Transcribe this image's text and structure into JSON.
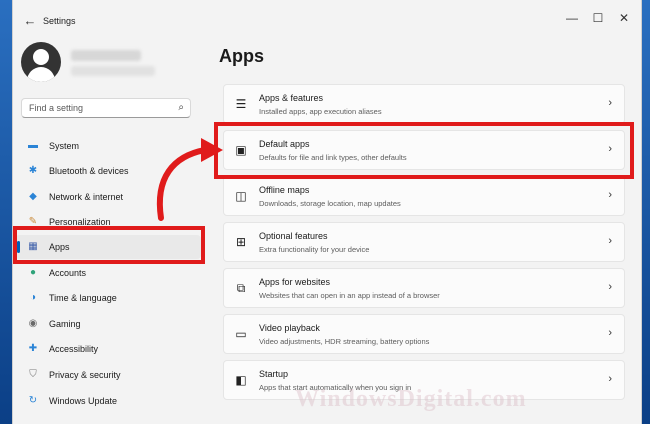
{
  "window": {
    "title": "Settings",
    "back_icon": "back-arrow-icon",
    "controls": {
      "minimize": "—",
      "maximize": "☐",
      "close": "✕"
    }
  },
  "search": {
    "placeholder": "Find a setting",
    "icon": "search-icon"
  },
  "sidebar": {
    "items": [
      {
        "label": "System",
        "icon": "monitor-icon",
        "color": "#2b84d6"
      },
      {
        "label": "Bluetooth & devices",
        "icon": "bluetooth-icon",
        "color": "#2b84d6"
      },
      {
        "label": "Network & internet",
        "icon": "wifi-icon",
        "color": "#2b84d6"
      },
      {
        "label": "Personalization",
        "icon": "brush-icon",
        "color": "#c98a3a"
      },
      {
        "label": "Apps",
        "icon": "apps-icon",
        "color": "#3a5ca8",
        "active": true
      },
      {
        "label": "Accounts",
        "icon": "person-icon",
        "color": "#2fa37a"
      },
      {
        "label": "Time & language",
        "icon": "globe-clock-icon",
        "color": "#2b84d6"
      },
      {
        "label": "Gaming",
        "icon": "gamepad-icon",
        "color": "#6a6a6a"
      },
      {
        "label": "Accessibility",
        "icon": "accessibility-icon",
        "color": "#2b84d6"
      },
      {
        "label": "Privacy & security",
        "icon": "shield-icon",
        "color": "#7a7a7a"
      },
      {
        "label": "Windows Update",
        "icon": "update-icon",
        "color": "#2b84d6"
      }
    ]
  },
  "main": {
    "title": "Apps",
    "cards": [
      {
        "title": "Apps & features",
        "subtitle": "Installed apps, app execution aliases",
        "icon": "list-icon"
      },
      {
        "title": "Default apps",
        "subtitle": "Defaults for file and link types, other defaults",
        "icon": "default-apps-icon"
      },
      {
        "title": "Offline maps",
        "subtitle": "Downloads, storage location, map updates",
        "icon": "map-icon"
      },
      {
        "title": "Optional features",
        "subtitle": "Extra functionality for your device",
        "icon": "add-box-icon"
      },
      {
        "title": "Apps for websites",
        "subtitle": "Websites that can open in an app instead of a browser",
        "icon": "open-in-app-icon"
      },
      {
        "title": "Video playback",
        "subtitle": "Video adjustments, HDR streaming, battery options",
        "icon": "video-icon"
      },
      {
        "title": "Startup",
        "subtitle": "Apps that start automatically when you sign in",
        "icon": "startup-icon"
      }
    ]
  },
  "watermark": "WindowsDigital.com",
  "highlight_color": "#e01b1b"
}
